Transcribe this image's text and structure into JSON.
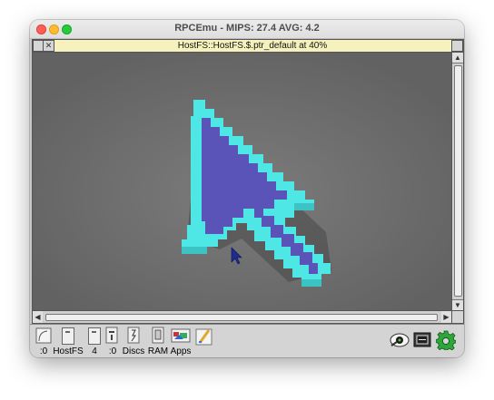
{
  "mac_window": {
    "title": "RPCEmu - MIPS: 27.4 AVG: 4.2"
  },
  "viewer_window": {
    "title": "HostFS::HostFS.$.ptr_default at 40%"
  },
  "iconbar": {
    "items": [
      {
        "label": ":0",
        "icon": "floppy-icon"
      },
      {
        "label": "HostFS",
        "icon": "hostfs-drive-icon"
      },
      {
        "label": "4",
        "icon": "harddisc-4-icon"
      },
      {
        "label": ":0",
        "icon": "harddisc-0-icon"
      },
      {
        "label": "Discs",
        "icon": "discs-icon"
      },
      {
        "label": "RAM",
        "icon": "ram-disc-icon"
      },
      {
        "label": "Apps",
        "icon": "apps-icon"
      },
      {
        "label": "",
        "icon": "paint-icon"
      },
      {
        "label": "",
        "icon": "spy-icon"
      },
      {
        "label": "",
        "icon": "display-icon"
      },
      {
        "label": "",
        "icon": "settings-gear-icon"
      }
    ]
  },
  "colors": {
    "cursor_outline": "#4fe6e6",
    "cursor_fill": "#5a54b8",
    "cursor_shadow": "#41b8b8",
    "canvas_background": "#6e6e6e",
    "title_yellow": "#f6f2bd"
  }
}
